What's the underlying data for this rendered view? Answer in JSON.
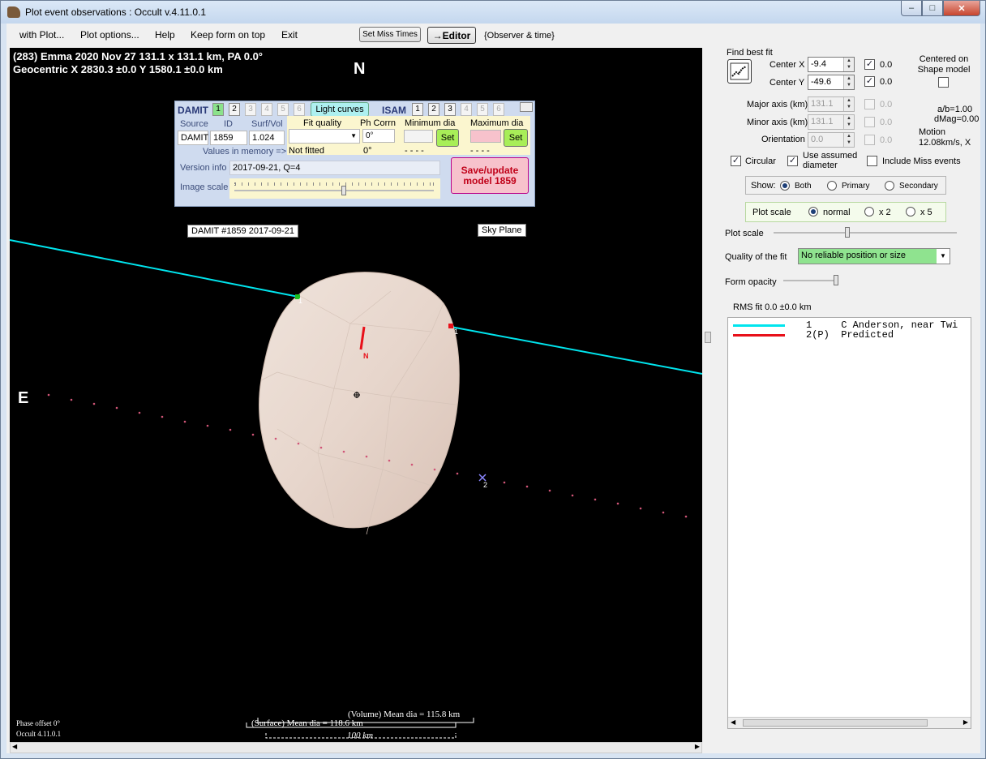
{
  "window": {
    "title": "Plot event observations : Occult v.4.11.0.1",
    "minimize": "‒",
    "maximize": "□",
    "close": "✕"
  },
  "menu": {
    "with_plot": "with Plot...",
    "plot_options": "Plot options...",
    "help": "Help",
    "keep_on_top": "Keep form on top",
    "exit": "Exit",
    "set_miss_times": "Set Miss Times",
    "editor": "→Editor",
    "observer_time": "{Observer & time}"
  },
  "plot": {
    "header_line1": "(283) Emma  2020 Nov 27  131.1 x 131.1 km, PA 0.0°",
    "header_line2": "Geocentric  X  2830.3 ±0.0  Y 1580.1 ±0.0 km",
    "north": "N",
    "east": "E",
    "model_label": "DAMIT #1859 2017-09-21",
    "sky_plane": "Sky Plane",
    "chord1_label": "1",
    "chord1_end_label": "1",
    "miss_label": "2",
    "axis_n_label": "N",
    "phase_offset": "Phase offset 0°",
    "occult_version": "Occult 4.11.0.1",
    "volume_dia": "(Volume) Mean dia = 115.8 km",
    "surface_dia": "(Surface) Mean dia = 118.6 km",
    "scale_bar": "100 km"
  },
  "damit": {
    "title": "DAMIT",
    "damit_numbers": [
      "1",
      "2",
      "3",
      "4",
      "5",
      "6"
    ],
    "light_curves": "Light curves",
    "isam_title": "ISAM",
    "isam_numbers": [
      "1",
      "2",
      "3",
      "4",
      "5",
      "6"
    ],
    "source_label": "Source",
    "id_label": "ID",
    "surfvol_label": "Surf/Vol",
    "source_value": "DAMIT",
    "id_value": "1859",
    "surfvol_value": "1.024",
    "values_in_memory": "Values in memory =>",
    "fit_quality_label": "Fit quality",
    "fit_quality_value": "Not fitted",
    "ph_corrn_label": "Ph Corrn",
    "ph_corrn_input": "0°",
    "ph_corrn_value": "0°",
    "min_dia_label": "Minimum dia",
    "min_dia_value": "- - - -",
    "max_dia_label": "Maximum dia",
    "max_dia_value": "- - - -",
    "set": "Set",
    "version_info_label": "Version info",
    "version_info_value": "2017-09-21, Q=4",
    "image_scale_label": "Image scale",
    "save_update": "Save/update model 1859",
    "image_scale_level": 0.55
  },
  "right": {
    "find_best_fit": "Find best fit",
    "center_x_label": "Center X",
    "center_x_value": "-9.4",
    "center_x_result": "0.0",
    "center_y_label": "Center Y",
    "center_y_value": "-49.6",
    "center_y_result": "0.0",
    "centered_on_shape": "Centered on Shape model",
    "major_axis_label": "Major axis (km)",
    "major_axis_value": "131.1",
    "major_axis_result": "0.0",
    "minor_axis_label": "Minor axis (km)",
    "minor_axis_value": "131.1",
    "minor_axis_result": "0.0",
    "orientation_label": "Orientation",
    "orientation_value": "0.0",
    "orientation_result": "0.0",
    "ab_ratio": "a/b=1.00",
    "dmag": "dMag=0.00",
    "motion_label": "Motion",
    "motion_value": "12.08km/s, X",
    "circular": "Circular",
    "use_assumed_diameter": "Use assumed diameter",
    "include_miss": "Include Miss events",
    "show_label": "Show:",
    "show_both": "Both",
    "show_primary": "Primary",
    "show_secondary": "Secondary",
    "plot_scale_group": "Plot scale",
    "scale_normal": "normal",
    "scale_x2": "x 2",
    "scale_x5": "x 5",
    "plot_scale_label": "Plot scale",
    "quality_label": "Quality of the fit",
    "quality_value": "No reliable position or size",
    "form_opacity": "Form opacity",
    "rms_fit": "RMS fit 0.0 ±0.0 km",
    "plot_scale_level": 0.4,
    "form_opacity_level": 1.0
  },
  "legend": {
    "row1": "1     C Anderson, near Twi",
    "row2": "2(P)  Predicted",
    "row1_color": "#00e5ee",
    "row2_color": "#e8101a"
  },
  "colors": {
    "chord": "#00e5ee",
    "predicted": "#e8101a",
    "asteroid_fill": "#e8d8cf",
    "quality_bg": "#8fe38f",
    "save_bg": "#f7c2cc",
    "save_text": "#c00018"
  }
}
